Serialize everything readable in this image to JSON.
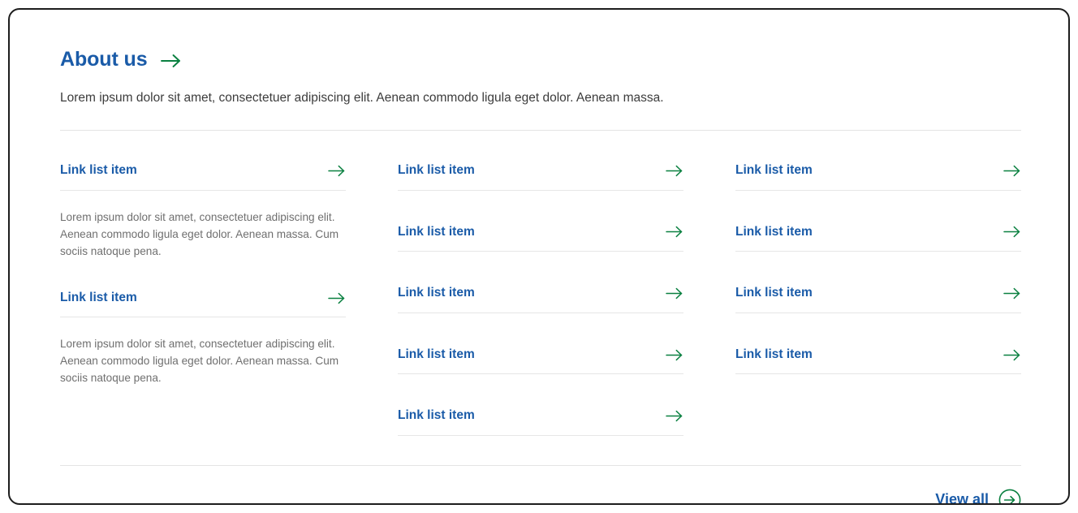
{
  "section": {
    "title": "About us",
    "title_arrow_icon": "arrow-right-icon",
    "intro": "Lorem ipsum dolor sit amet, consectetuer adipiscing elit. Aenean commodo ligula eget dolor. Aenean massa."
  },
  "columns": [
    {
      "id": "column-1",
      "blocks": [
        {
          "link": "Link list item",
          "arrow_icon": "arrow-right-icon",
          "blurb": "Lorem ipsum dolor sit amet, consectetuer adipiscing elit. Aenean commodo ligula eget dolor. Aenean massa. Cum sociis natoque pena."
        },
        {
          "link": "Link list item",
          "arrow_icon": "arrow-right-icon",
          "blurb": "Lorem ipsum dolor sit amet, consectetuer adipiscing elit. Aenean commodo ligula eget dolor. Aenean massa. Cum sociis natoque pena."
        }
      ]
    },
    {
      "id": "column-2",
      "items": [
        {
          "link": "Link list item",
          "arrow_icon": "arrow-right-icon"
        },
        {
          "link": "Link list item",
          "arrow_icon": "arrow-right-icon"
        },
        {
          "link": "Link list item",
          "arrow_icon": "arrow-right-icon"
        },
        {
          "link": "Link list item",
          "arrow_icon": "arrow-right-icon"
        },
        {
          "link": "Link list item",
          "arrow_icon": "arrow-right-icon"
        }
      ]
    },
    {
      "id": "column-3",
      "items": [
        {
          "link": "Link list item",
          "arrow_icon": "arrow-right-icon"
        },
        {
          "link": "Link list item",
          "arrow_icon": "arrow-right-icon"
        },
        {
          "link": "Link list item",
          "arrow_icon": "arrow-right-icon"
        },
        {
          "link": "Link list item",
          "arrow_icon": "arrow-right-icon"
        }
      ]
    }
  ],
  "footer": {
    "view_all_label": "View all",
    "view_all_icon": "arrow-right-circle-icon"
  },
  "colors": {
    "link_blue": "#1a5ba8",
    "arrow_green": "#0a8040",
    "body_gray": "#6f6f6f",
    "intro_gray": "#3c3c3c",
    "divider": "#e6e6e6",
    "frame": "#1d1d1d"
  }
}
